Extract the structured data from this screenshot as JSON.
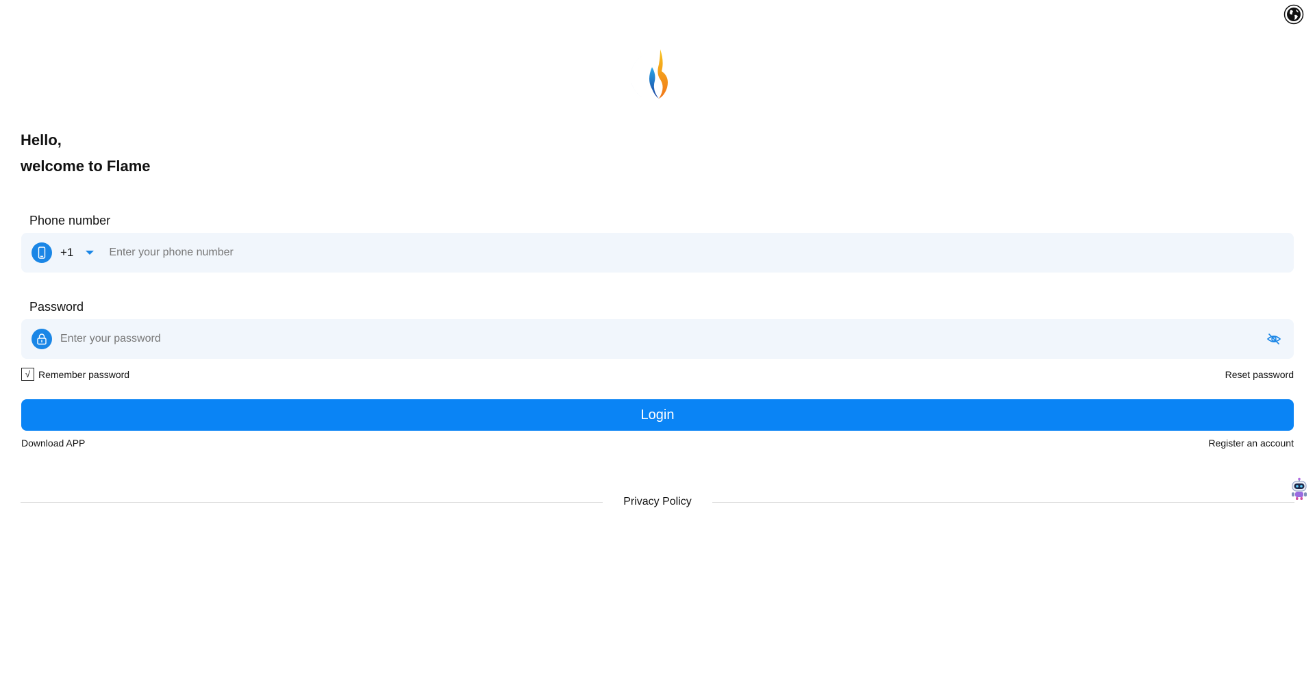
{
  "header": {
    "language_icon": "globe-icon"
  },
  "brand": {
    "logo_icon": "flame-logo",
    "colors": {
      "blue": "#1a5fc7",
      "orange": "#f5a21c",
      "red": "#e5392c"
    }
  },
  "greeting": {
    "line1": "Hello,",
    "line2": "welcome to Flame"
  },
  "phone": {
    "label": "Phone number",
    "icon": "phone-icon",
    "country_code": "+1",
    "placeholder": "Enter your phone number",
    "value": ""
  },
  "password": {
    "label": "Password",
    "icon": "lock-icon",
    "placeholder": "Enter your password",
    "value": "",
    "toggle_icon": "eye-off-icon"
  },
  "options": {
    "remember_label": "Remember password",
    "remember_mark": "√",
    "remember_checked": true,
    "reset_label": "Reset password"
  },
  "actions": {
    "login_label": "Login",
    "download_label": "Download APP",
    "register_label": "Register an account"
  },
  "footer": {
    "privacy_label": "Privacy Policy"
  },
  "assistant": {
    "icon": "robot-icon"
  },
  "theme": {
    "accent": "#0a84f5",
    "field_bg": "#f1f6fc",
    "icon_bg": "#1a86e6"
  }
}
